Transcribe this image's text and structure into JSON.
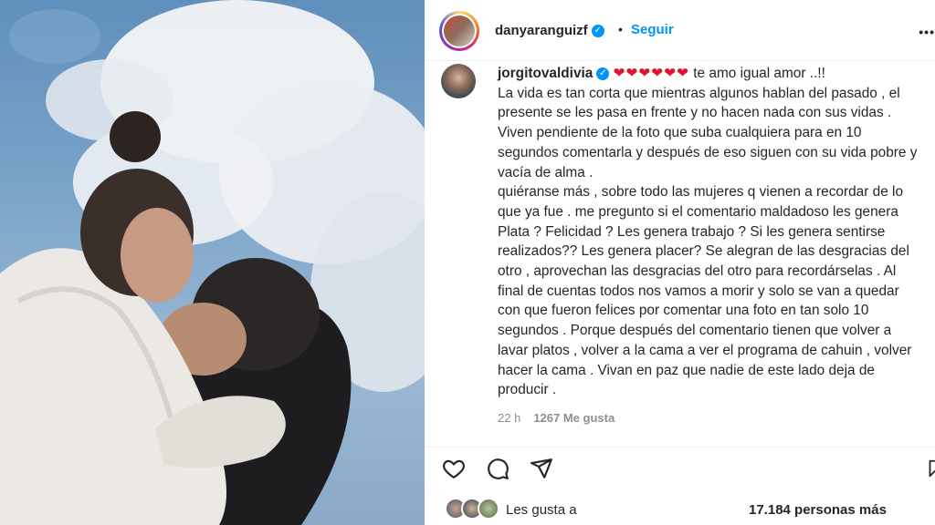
{
  "post": {
    "username": "danyaranguizf",
    "separator": "•",
    "follow_label": "Seguir",
    "more_label": "•"
  },
  "comment": {
    "username": "jorgitovaldivia",
    "hearts": "❤❤❤❤❤❤",
    "text": " te amo igual amor ..!!\nLa vida es tan corta que mientras algunos hablan del pasado , el presente se les pasa en frente y no hacen nada con sus vidas . Viven pendiente de la foto que suba cualquiera para en 10 segundos comentarla y después de eso siguen con su vida pobre y vacía de alma .\nquiéranse más , sobre todo las mujeres q vienen a recordar de lo que ya fue . me pregunto si el comentario maldadoso les genera Plata ? Felicidad ? Les genera trabajo ? Si les genera sentirse realizados?? Les genera placer? Se alegran de las desgracias del otro , aprovechan las desgracias del otro para recordárselas . Al final de cuentas todos nos vamos a morir y solo se van a quedar con que fueron felices por comentar una foto en tan solo 10 segundos . Porque después del comentario tienen que volver a lavar platos , volver a la cama a ver el programa de cahuin , volver hacer la cama . Vivan en paz que nadie de este lado deja de producir .",
    "time": "22 h",
    "likes": "1267 Me gusta"
  },
  "actions": {
    "like_icon": "heart-icon",
    "comment_icon": "comment-icon",
    "share_icon": "share-icon",
    "save_icon": "bookmark-icon"
  },
  "liked_by": {
    "text": "Les gusta a",
    "others": "17.184 personas más"
  },
  "colors": {
    "accent": "#0095f6",
    "heart": "#e0142b",
    "muted": "#8e8e8e"
  }
}
